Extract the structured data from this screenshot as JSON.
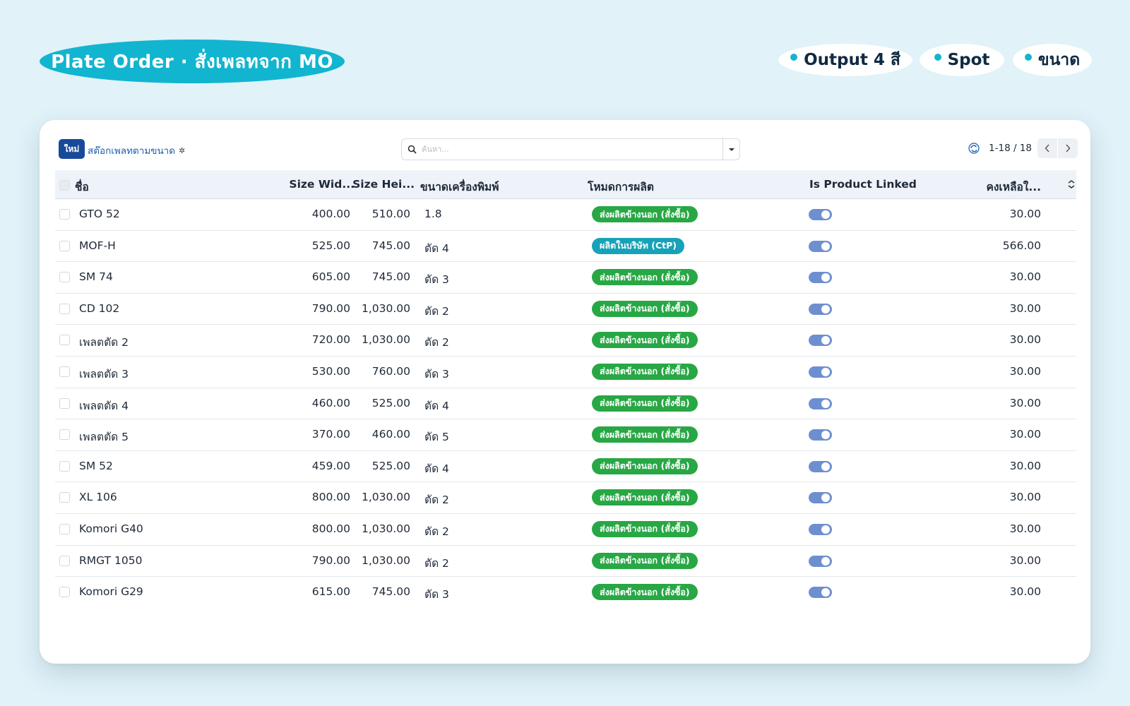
{
  "header": {
    "title": "Plate Order · สั่งเพลทจาก MO",
    "chips": [
      "Output 4 สี",
      "Spot",
      "ขนาด"
    ],
    "accent_color": "#12b5cf"
  },
  "toolbar": {
    "new_label": "ใหม่",
    "breadcrumb": "สต๊อกเพลทตามขนาด",
    "settings_icon": "gear-icon",
    "search_placeholder": "ค้นหา...",
    "pager_text": "1-18 / 18"
  },
  "table": {
    "columns": [
      "ชื่อ",
      "Size Wid...",
      "Size Hei...",
      "ขนาดเครื่องพิมพ์",
      "โหมดการผลิต",
      "Is Product Linked",
      "คงเหลือใ..."
    ],
    "rows": [
      {
        "name": "GTO 52",
        "width": "400.00",
        "height": "510.00",
        "machine_size": "1.8",
        "mode": "ส่งผลิตข้างนอก (สั่งซื้อ)",
        "mode_type": "green",
        "linked": true,
        "remaining": "30.00"
      },
      {
        "name": "MOF-H",
        "width": "525.00",
        "height": "745.00",
        "machine_size": "ตัด 4",
        "mode": "ผลิตในบริษัท (CtP)",
        "mode_type": "teal",
        "linked": true,
        "remaining": "566.00"
      },
      {
        "name": "SM 74",
        "width": "605.00",
        "height": "745.00",
        "machine_size": "ตัด 3",
        "mode": "ส่งผลิตข้างนอก (สั่งซื้อ)",
        "mode_type": "green",
        "linked": true,
        "remaining": "30.00"
      },
      {
        "name": "CD 102",
        "width": "790.00",
        "height": "1,030.00",
        "machine_size": "ตัด 2",
        "mode": "ส่งผลิตข้างนอก (สั่งซื้อ)",
        "mode_type": "green",
        "linked": true,
        "remaining": "30.00"
      },
      {
        "name": "เพลตตัด 2",
        "width": "720.00",
        "height": "1,030.00",
        "machine_size": "ตัด 2",
        "mode": "ส่งผลิตข้างนอก (สั่งซื้อ)",
        "mode_type": "green",
        "linked": true,
        "remaining": "30.00"
      },
      {
        "name": "เพลตตัด 3",
        "width": "530.00",
        "height": "760.00",
        "machine_size": "ตัด 3",
        "mode": "ส่งผลิตข้างนอก (สั่งซื้อ)",
        "mode_type": "green",
        "linked": true,
        "remaining": "30.00"
      },
      {
        "name": "เพลตตัด 4",
        "width": "460.00",
        "height": "525.00",
        "machine_size": "ตัด 4",
        "mode": "ส่งผลิตข้างนอก (สั่งซื้อ)",
        "mode_type": "green",
        "linked": true,
        "remaining": "30.00"
      },
      {
        "name": "เพลตตัด 5",
        "width": "370.00",
        "height": "460.00",
        "machine_size": "ตัด 5",
        "mode": "ส่งผลิตข้างนอก (สั่งซื้อ)",
        "mode_type": "green",
        "linked": true,
        "remaining": "30.00"
      },
      {
        "name": "SM 52",
        "width": "459.00",
        "height": "525.00",
        "machine_size": "ตัด 4",
        "mode": "ส่งผลิตข้างนอก (สั่งซื้อ)",
        "mode_type": "green",
        "linked": true,
        "remaining": "30.00"
      },
      {
        "name": "XL 106",
        "width": "800.00",
        "height": "1,030.00",
        "machine_size": "ตัด 2",
        "mode": "ส่งผลิตข้างนอก (สั่งซื้อ)",
        "mode_type": "green",
        "linked": true,
        "remaining": "30.00"
      },
      {
        "name": "Komori G40",
        "width": "800.00",
        "height": "1,030.00",
        "machine_size": "ตัด 2",
        "mode": "ส่งผลิตข้างนอก (สั่งซื้อ)",
        "mode_type": "green",
        "linked": true,
        "remaining": "30.00"
      },
      {
        "name": "RMGT 1050",
        "width": "790.00",
        "height": "1,030.00",
        "machine_size": "ตัด 2",
        "mode": "ส่งผลิตข้างนอก (สั่งซื้อ)",
        "mode_type": "green",
        "linked": true,
        "remaining": "30.00"
      },
      {
        "name": "Komori G29",
        "width": "615.00",
        "height": "745.00",
        "machine_size": "ตัด 3",
        "mode": "ส่งผลิตข้างนอก (สั่งซื้อ)",
        "mode_type": "green",
        "linked": true,
        "remaining": "30.00"
      }
    ]
  },
  "colors": {
    "badge_green": "#28a745",
    "badge_teal": "#17a2b8",
    "toggle_on": "#6e8fcf",
    "primary": "#184a9a"
  }
}
